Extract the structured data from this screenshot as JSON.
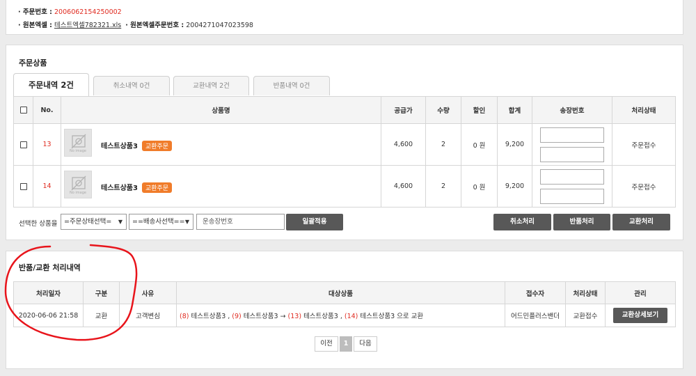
{
  "order_info": {
    "order_no_label": "· 주문번호 :",
    "order_no": "2006062154250002",
    "excel_label": "· 원본엑셀 :",
    "excel_file": "테스트엑셀782321.xls",
    "excel_order_label": "· 원본엑셀주문번호 :",
    "excel_order_no": "2004271047023598"
  },
  "order_items": {
    "title": "주문상품",
    "tabs": [
      {
        "label": "주문내역 2건",
        "active": true
      },
      {
        "label": "취소내역 0건",
        "active": false
      },
      {
        "label": "교환내역 2건",
        "active": false
      },
      {
        "label": "반품내역 0건",
        "active": false
      }
    ],
    "columns": [
      "No.",
      "상품명",
      "공급가",
      "수량",
      "할인",
      "합계",
      "송장번호",
      "처리상태"
    ],
    "no_image_text": "No image",
    "rows": [
      {
        "no": "13",
        "name": "테스트상품3",
        "badge": "교환주문",
        "price": "4,600",
        "qty": "2",
        "discount": "0 원",
        "total": "9,200",
        "status": "주문접수"
      },
      {
        "no": "14",
        "name": "테스트상품3",
        "badge": "교환주문",
        "price": "4,600",
        "qty": "2",
        "discount": "0 원",
        "total": "9,200",
        "status": "주문접수"
      }
    ],
    "bulk": {
      "label": "선택한 상품을",
      "status_select": "=주문상태선택=",
      "courier_select": "==배송사선택==",
      "invoice_placeholder": "운송장번호",
      "apply_button": "일괄적용",
      "cancel_button": "취소처리",
      "return_button": "반품처리",
      "exchange_button": "교환처리"
    }
  },
  "history": {
    "title": "반품/교환 처리내역",
    "columns": [
      "처리일자",
      "구분",
      "사유",
      "대상상품",
      "접수자",
      "처리상태",
      "관리"
    ],
    "rows": [
      {
        "date": "2020-06-06 21:58",
        "type": "교환",
        "reason": "고객변심",
        "no_a": "(8)",
        "seg_a": " 테스트상품3 , ",
        "no_b": "(9)",
        "seg_b": " 테스트상품3 → ",
        "no_c": "(13)",
        "seg_c": " 테스트상품3 , ",
        "no_d": "(14)",
        "seg_d": " 테스트상품3 으로 교환",
        "receiver": "어드민플러스밴더",
        "status": "교환접수",
        "detail_button": "교환상세보기"
      }
    ],
    "pagination": {
      "prev": "이전",
      "current": "1",
      "next": "다음"
    }
  },
  "colors": {
    "accent_red": "#e02b20",
    "badge_orange": "#f07c2a",
    "dark_button": "#585858",
    "annotation_red": "#e8141b"
  }
}
